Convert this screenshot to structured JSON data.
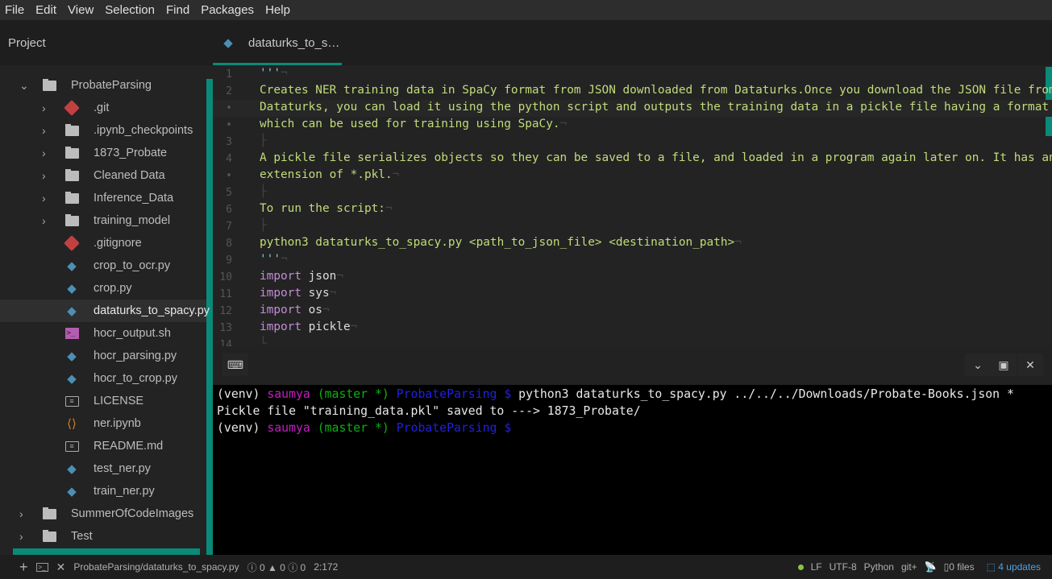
{
  "menu": [
    "File",
    "Edit",
    "View",
    "Selection",
    "Find",
    "Packages",
    "Help"
  ],
  "sidebar": {
    "title": "Project",
    "items": [
      {
        "label": "ProbateParsing",
        "icon": "folder-icon",
        "depth": 0,
        "expanded": true
      },
      {
        "label": ".git",
        "icon": "git-icon",
        "depth": 1,
        "chevron": true
      },
      {
        "label": ".ipynb_checkpoints",
        "icon": "folder-icon",
        "depth": 1,
        "chevron": true
      },
      {
        "label": "1873_Probate",
        "icon": "folder-icon",
        "depth": 1,
        "chevron": true
      },
      {
        "label": "Cleaned Data",
        "icon": "folder-icon",
        "depth": 1,
        "chevron": true
      },
      {
        "label": "Inference_Data",
        "icon": "folder-icon",
        "depth": 1,
        "chevron": true
      },
      {
        "label": "training_model",
        "icon": "folder-icon",
        "depth": 1,
        "chevron": true
      },
      {
        "label": ".gitignore",
        "icon": "git-icon",
        "depth": 1
      },
      {
        "label": "crop_to_ocr.py",
        "icon": "python-icon",
        "depth": 1
      },
      {
        "label": "crop.py",
        "icon": "python-icon",
        "depth": 1
      },
      {
        "label": "dataturks_to_spacy.py",
        "icon": "python-icon",
        "depth": 1,
        "selected": true
      },
      {
        "label": "hocr_output.sh",
        "icon": "shell-icon",
        "depth": 1
      },
      {
        "label": "hocr_parsing.py",
        "icon": "python-icon",
        "depth": 1
      },
      {
        "label": "hocr_to_crop.py",
        "icon": "python-icon",
        "depth": 1
      },
      {
        "label": "LICENSE",
        "icon": "book-icon",
        "depth": 1
      },
      {
        "label": "ner.ipynb",
        "icon": "notebook-icon",
        "depth": 1
      },
      {
        "label": "README.md",
        "icon": "book-icon",
        "depth": 1
      },
      {
        "label": "test_ner.py",
        "icon": "python-icon",
        "depth": 1
      },
      {
        "label": "train_ner.py",
        "icon": "python-icon",
        "depth": 1
      },
      {
        "label": "SummerOfCodeImages",
        "icon": "folder-icon",
        "depth": 0,
        "chevron": true
      },
      {
        "label": "Test",
        "icon": "folder-icon",
        "depth": 0,
        "chevron": true
      }
    ]
  },
  "tab": {
    "label": "dataturks_to_s…",
    "icon": "python-icon"
  },
  "editor": {
    "lines": [
      {
        "n": "1",
        "parts": [
          [
            "q",
            "'''"
          ],
          [
            "inv",
            "¬"
          ]
        ]
      },
      {
        "n": "2",
        "parts": [
          [
            "s",
            "Creates NER training data in SpaCy format from JSON downloaded from Dataturks.Once you download the JSON file from"
          ]
        ]
      },
      {
        "n": "•",
        "parts": [
          [
            "s",
            "Dataturks, you can load it using the python script and outputs the training data in a pickle file having a format"
          ]
        ],
        "cursor": true
      },
      {
        "n": "•",
        "parts": [
          [
            "s",
            "which can be used for training using SpaCy."
          ],
          [
            "inv",
            "¬"
          ]
        ]
      },
      {
        "n": "3",
        "parts": [
          [
            "inv",
            "├"
          ]
        ]
      },
      {
        "n": "4",
        "parts": [
          [
            "s",
            "A pickle file serializes objects so they can be saved to a file, and loaded in a program again later on. It has an"
          ]
        ]
      },
      {
        "n": "•",
        "parts": [
          [
            "s",
            "extension of *.pkl."
          ],
          [
            "inv",
            "¬"
          ]
        ]
      },
      {
        "n": "5",
        "parts": [
          [
            "inv",
            "├"
          ]
        ]
      },
      {
        "n": "6",
        "parts": [
          [
            "s",
            "To run the script:"
          ],
          [
            "inv",
            "¬"
          ]
        ]
      },
      {
        "n": "7",
        "parts": [
          [
            "inv",
            "├"
          ]
        ]
      },
      {
        "n": "8",
        "parts": [
          [
            "s",
            "python3 dataturks_to_spacy.py <path_to_json_file> <destination_path>"
          ],
          [
            "inv",
            "¬"
          ]
        ]
      },
      {
        "n": "9",
        "parts": [
          [
            "q",
            "'''"
          ],
          [
            "inv",
            "¬"
          ]
        ]
      },
      {
        "n": "10",
        "parts": [
          [
            "kw",
            "import"
          ],
          [
            "pl",
            " json"
          ],
          [
            "inv",
            "¬"
          ]
        ]
      },
      {
        "n": "11",
        "parts": [
          [
            "kw",
            "import"
          ],
          [
            "pl",
            " sys"
          ],
          [
            "inv",
            "¬"
          ]
        ]
      },
      {
        "n": "12",
        "parts": [
          [
            "kw",
            "import"
          ],
          [
            "pl",
            " os"
          ],
          [
            "inv",
            "¬"
          ]
        ]
      },
      {
        "n": "13",
        "parts": [
          [
            "kw",
            "import"
          ],
          [
            "pl",
            " pickle"
          ],
          [
            "inv",
            "¬"
          ]
        ]
      },
      {
        "n": "14",
        "parts": [
          [
            "inv",
            "└"
          ]
        ]
      }
    ]
  },
  "terminal": {
    "lines": [
      [
        [
          "",
          "(venv) "
        ],
        [
          "u",
          "saumya"
        ],
        [
          "g",
          " (master *)"
        ],
        [
          "d",
          " ProbateParsing $"
        ],
        [
          "",
          " python3 dataturks_to_spacy.py ../../../Downloads/Probate-Books.json *"
        ]
      ],
      [
        [
          "",
          "Pickle file \"training_data.pkl\" saved to ---> 1873_Probate/"
        ]
      ],
      [
        [
          "",
          "(venv) "
        ],
        [
          "u",
          "saumya"
        ],
        [
          "g",
          " (master *)"
        ],
        [
          "d",
          " ProbateParsing $"
        ]
      ]
    ]
  },
  "status": {
    "path": "ProbateParsing/dataturks_to_spacy.py",
    "errors": "0",
    "warnings": "0",
    "infos": "0",
    "cursor": "2:172",
    "line_ending": "LF",
    "encoding": "UTF-8",
    "grammar": "Python",
    "git": "git+",
    "files": "0 files",
    "updates": "4 updates"
  },
  "colors": {
    "accent": "#0a8a78",
    "string": "#c1dc7a",
    "keyword": "#c58bd8",
    "updates": "#4fa3e0"
  }
}
